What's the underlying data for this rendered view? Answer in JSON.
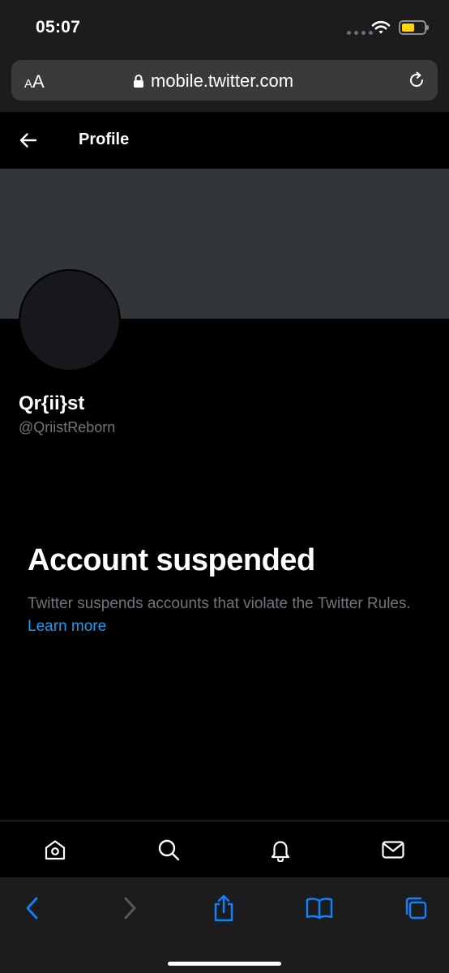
{
  "status_bar": {
    "time": "05:07"
  },
  "browser": {
    "aa_label_small": "A",
    "aa_label_big": "A",
    "url": "mobile.twitter.com"
  },
  "header": {
    "title": "Profile"
  },
  "profile": {
    "display_name": "Qr{ii}st",
    "handle": "@QriistReborn"
  },
  "suspension": {
    "title": "Account suspended",
    "message": "Twitter suspends accounts that violate the Twitter Rules.",
    "link_label": "Learn more"
  },
  "bottom_nav": {
    "icons": [
      "home-icon",
      "search-icon",
      "bell-icon",
      "mail-icon"
    ]
  },
  "safari_toolbar": {
    "icons": [
      "back-icon",
      "forward-icon",
      "share-icon",
      "bookmarks-icon",
      "tabs-icon"
    ]
  },
  "colors": {
    "link": "#1d9bf0",
    "muted": "#71767b",
    "banner": "#333639",
    "safari_accent": "#0a84ff"
  }
}
